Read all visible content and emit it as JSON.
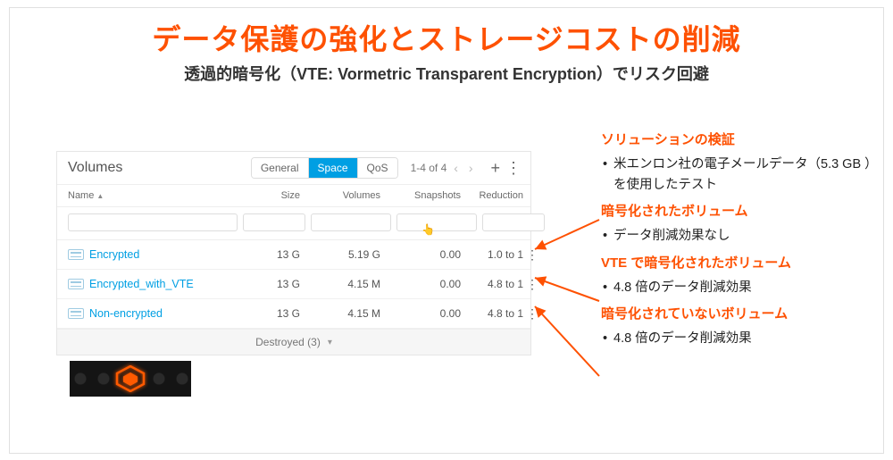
{
  "title": "データ保護の強化とストレージコストの削減",
  "subtitle": "透過的暗号化（VTE: Vormetric Transparent Encryption）でリスク回避",
  "panel": {
    "heading": "Volumes",
    "tabs": {
      "general": "General",
      "space": "Space",
      "qos": "QoS"
    },
    "count": "1-4 of 4",
    "columns": {
      "name": "Name",
      "size": "Size",
      "volumes": "Volumes",
      "snapshots": "Snapshots",
      "reduction": "Reduction"
    },
    "rows": [
      {
        "name": "Encrypted",
        "size": "13 G",
        "volumes": "5.19 G",
        "snapshots": "0.00",
        "reduction": "1.0 to 1"
      },
      {
        "name": "Encrypted_with_VTE",
        "size": "13 G",
        "volumes": "4.15 M",
        "snapshots": "0.00",
        "reduction": "4.8 to 1"
      },
      {
        "name": "Non-encrypted",
        "size": "13 G",
        "volumes": "4.15 M",
        "snapshots": "0.00",
        "reduction": "4.8 to 1"
      }
    ],
    "footer": "Destroyed (3)"
  },
  "right": {
    "s1": {
      "h": "ソリューションの検証",
      "b": "米エンロン社の電子メールデータ（5.3 GB ）を使用したテスト"
    },
    "s2": {
      "h": "暗号化されたボリューム",
      "b": "データ削減効果なし"
    },
    "s3": {
      "h": "VTE で暗号化されたボリューム",
      "b": "4.8 倍のデータ削減効果"
    },
    "s4": {
      "h": "暗号化されていないボリューム",
      "b": "4.8 倍のデータ削減効果"
    }
  }
}
